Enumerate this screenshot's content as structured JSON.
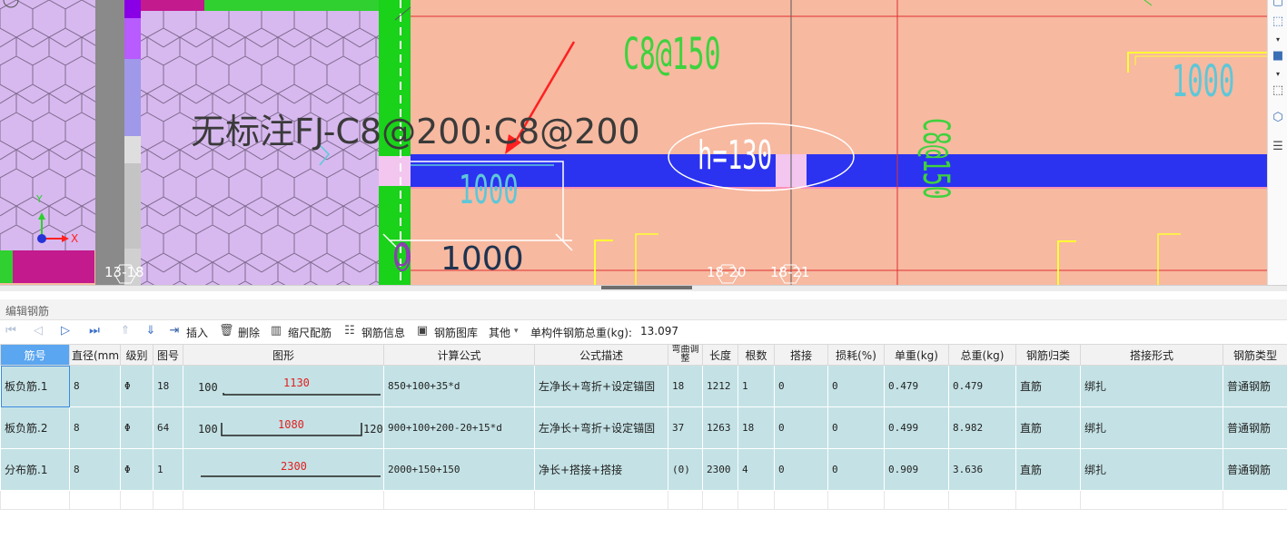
{
  "cad": {
    "annotation": "无标注FJ-C8@200:C8@200",
    "dim_black": "1000",
    "dim_cyan": "1000",
    "dim_right": "1000",
    "rebar_top": "C8@150",
    "rebar_vertical": "C8@150",
    "slab_thickness": "h=130",
    "zero_label": "0",
    "axes": [
      "13-18",
      "18-20",
      "18-21"
    ],
    "coord_x": "X",
    "coord_y": "Y"
  },
  "panel": {
    "title": "编辑钢筋"
  },
  "toolbar": {
    "insert": "插入",
    "delete": "删除",
    "scale_rebar": "缩尺配筋",
    "rebar_info": "钢筋信息",
    "rebar_library": "钢筋图库",
    "other": "其他",
    "total_weight_label": "单构件钢筋总重(kg):",
    "total_weight_value": "13.097"
  },
  "table": {
    "headers": [
      "筋号",
      "直径(mm)",
      "级别",
      "图号",
      "图形",
      "计算公式",
      "公式描述",
      "弯曲调整",
      "长度",
      "根数",
      "搭接",
      "损耗(%)",
      "单重(kg)",
      "总重(kg)",
      "钢筋归类",
      "搭接形式",
      "钢筋类型"
    ],
    "rows": [
      {
        "name": "板负筋.1",
        "diameter": "8",
        "grade": "Φ",
        "shape_no": "18",
        "shape_left": "100",
        "shape_mid": "1130",
        "shape_right": "",
        "formula": "850+100+35*d",
        "description": "左净长+弯折+设定锚固",
        "bend": "18",
        "length": "1212",
        "count": "1",
        "lap": "0",
        "loss": "0",
        "unit_weight": "0.479",
        "total_weight": "0.479",
        "category": "直筋",
        "lap_form": "绑扎",
        "type": "普通钢筋"
      },
      {
        "name": "板负筋.2",
        "diameter": "8",
        "grade": "Φ",
        "shape_no": "64",
        "shape_left": "100",
        "shape_mid": "1080",
        "shape_right": "120",
        "formula": "900+100+200-20+15*d",
        "description": "左净长+弯折+设定锚固",
        "bend": "37",
        "length": "1263",
        "count": "18",
        "lap": "0",
        "loss": "0",
        "unit_weight": "0.499",
        "total_weight": "8.982",
        "category": "直筋",
        "lap_form": "绑扎",
        "type": "普通钢筋"
      },
      {
        "name": "分布筋.1",
        "diameter": "8",
        "grade": "Φ",
        "shape_no": "1",
        "shape_left": "",
        "shape_mid": "2300",
        "shape_right": "",
        "formula": "2000+150+150",
        "description": "净长+搭接+搭接",
        "bend": "(0)",
        "length": "2300",
        "count": "4",
        "lap": "0",
        "loss": "0",
        "unit_weight": "0.909",
        "total_weight": "3.636",
        "category": "直筋",
        "lap_form": "绑扎",
        "type": "普通钢筋"
      }
    ]
  },
  "colors": {
    "slab": "#f7b9a0",
    "beam_blue": "#2b33f0",
    "hex_fill": "#d7b9ef",
    "row_bg": "#c4e2e5",
    "header_selected": "#5aa6f0"
  }
}
